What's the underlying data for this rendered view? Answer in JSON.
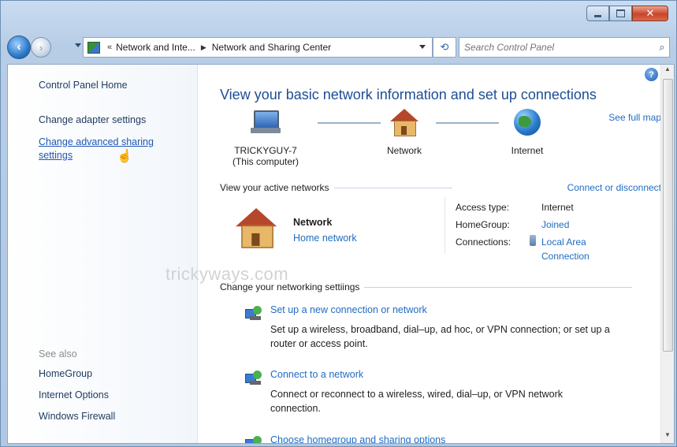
{
  "window": {
    "caption_buttons": {
      "minimize": "minimize",
      "maximize": "maximize",
      "close": "✕"
    }
  },
  "navbar": {
    "back_icon": "back-arrow",
    "forward_icon": "forward-arrow",
    "breadcrumb": {
      "overflow": "«",
      "items": [
        "Network and Inte...",
        "Network and Sharing Center"
      ]
    },
    "search_placeholder": "Search Control Panel"
  },
  "sidebar": {
    "home": "Control Panel Home",
    "links": [
      "Change adapter settings",
      "Change advanced sharing",
      "settings"
    ],
    "see_also_heading": "See also",
    "see_also": [
      "HomeGroup",
      "Internet Options",
      "Windows Firewall"
    ]
  },
  "watermark": "trickyways.com",
  "main": {
    "title": "View your basic network information and set up connections",
    "see_full_map": "See full map",
    "map": {
      "computer_name": "TRICKYGUY-7",
      "computer_sub": "(This computer)",
      "network": "Network",
      "internet": "Internet"
    },
    "active_networks": {
      "heading": "View your active networks",
      "connect_link": "Connect or disconnect",
      "name": "Network",
      "type": "Home network",
      "access_type_label": "Access type:",
      "access_type_value": "Internet",
      "homegroup_label": "HomeGroup:",
      "homegroup_value": "Joined",
      "connections_label": "Connections:",
      "connections_value_1": "Local Area",
      "connections_value_2": "Connection"
    },
    "settings": {
      "heading": "Change your networking settiings",
      "tasks": [
        {
          "title": "Set up a new connection or network",
          "desc_1": "Set up a wireless, broadband, dial–up, ad hoc, or VPN connection; or set up a",
          "desc_2": "router or access point."
        },
        {
          "title": "Connect to a network",
          "desc_1": "Connect or reconnect to a wireless, wired, dial–up, or VPN network",
          "desc_2": "connection."
        },
        {
          "title": "Choose homegroup and sharing options"
        }
      ]
    }
  }
}
